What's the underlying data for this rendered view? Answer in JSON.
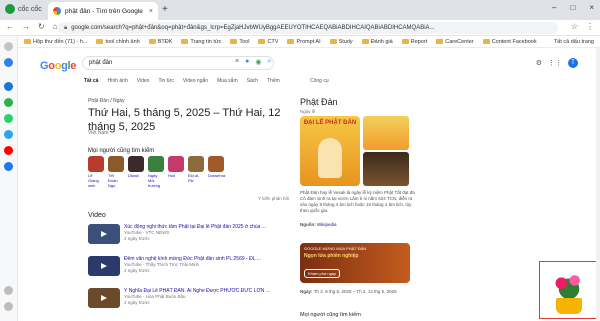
{
  "browser": {
    "brand": "cốc cốc",
    "tab_title": "phật đản - Tìm trên Google",
    "tab_close": "×",
    "new_tab": "+",
    "window_buttons": [
      "–",
      "□",
      "×"
    ],
    "nav_icons": [
      "←",
      "→",
      "↻",
      "⌂"
    ],
    "url": "google.com/search?q=phật+đản&oq=phật+đản&gs_lcrp=EgZjaHJvbWUyBggAEEUYOTIHCAEQABiABDIHCAIQABiABDIHCAMQABiA...",
    "bookmarks": [
      "Hộp thư đến (71) - h...",
      "tool chỉnh ảnh",
      "BTĐK",
      "Trang tin tức",
      "Tool",
      "CTV",
      "Prompt AI",
      "Study",
      "Đánh giá",
      "Report",
      "CareCenter",
      "Content Facebook"
    ],
    "bookmarks_right": "Tất cả dấu trang"
  },
  "search": {
    "logo_letters": [
      "G",
      "o",
      "o",
      "g",
      "l",
      "e"
    ],
    "logo_colors": [
      "#4285f4",
      "#ea4335",
      "#fbbc05",
      "#4285f4",
      "#34a853",
      "#ea4335"
    ],
    "query": "phật đản",
    "filters": [
      "Tất cả",
      "Hình ảnh",
      "Video",
      "Tin tức",
      "Video ngắn",
      "Mua sắm",
      "Sách",
      "Thêm"
    ],
    "tools": "Công cụ",
    "avatar_letter": "T"
  },
  "result": {
    "breadcrumb": "Phật Đản / Ngày",
    "headline": "Thứ Hai, 5 tháng 5, 2025 – Thứ Hai, 12 tháng 5, 2025",
    "country": "Việt Nam",
    "also_searched": "Mọi người cũng tìm kiếm",
    "related": [
      {
        "label": "Lễ Giáng sinh",
        "color": "#b93a2e"
      },
      {
        "label": "Tết Đoan Ngọ",
        "color": "#8a5a2b"
      },
      {
        "label": "Diwali",
        "color": "#3a2a2a"
      },
      {
        "label": "Ngày Môi trường",
        "color": "#3a7f3e"
      },
      {
        "label": "Holi",
        "color": "#c43a6a"
      },
      {
        "label": "Eid al-Fitr",
        "color": "#8d6a3a"
      },
      {
        "label": "Dussehra",
        "color": "#a05a2a"
      }
    ],
    "feedback": "Ý kiến phản hồi",
    "videos_title": "Video",
    "videos": [
      {
        "title": "Xúc động nghi thức tắm Phật tại Đại lễ Phật đản 2025 ở chùa ...",
        "channel": "YouTube · VTC NEWS",
        "age": "2 ngày trước",
        "color": "#3a4f7a"
      },
      {
        "title": "Đêm văn nghệ kính mừng Đức Phật đản sinh PL.2569 - ĐL ...",
        "channel": "YouTube · Thầy Thích Trúc Thái Minh",
        "age": "2 ngày trước",
        "color": "#2a3a6a"
      },
      {
        "title": "Ý Nghĩa Đại Lễ PHẬT ĐẢN. Ai Nghe Được PHƯỚC ĐỨC LỚN ...",
        "channel": "YouTube · Hoa Phật Buôn Bầu",
        "age": "2 ngày trước",
        "color": "#6a4a2a"
      }
    ]
  },
  "knowledge_panel": {
    "title": "Phật Đản",
    "subtitle": "Ngày lễ",
    "main_image_text": "ĐẠI LỄ PHẬT ĐẢN",
    "description": "Phật Đản hay lễ Vesak là ngày lễ kỷ niệm Phật Tất đạt đa Cồ đàm sinh ra tại vườn Lâm tì ni năm 624 TCN, diễn ra vào ngày 8 tháng 4 âm lịch hoặc 15 tháng 4 âm lịch, tùy theo quốc gia.",
    "source_label": "Nguồn:",
    "source_link": "Wikipedia",
    "banner_small": "GOOGLE MỪNG MÙA PHẬT ĐẢN",
    "banner_big": "Ngọn lửa phiên nghiệp",
    "banner_button": "Khám phá ngay",
    "date_label": "Ngày:",
    "date_value": "Th 2, 5 thg 5, 2025 – Th 2, 12 thg 5, 2025",
    "also_searched": "Mọi người cũng tìm kiếm"
  },
  "icons": [
    "mic-icon",
    "lens-icon",
    "clear-icon",
    "gear-icon",
    "apps-icon"
  ]
}
